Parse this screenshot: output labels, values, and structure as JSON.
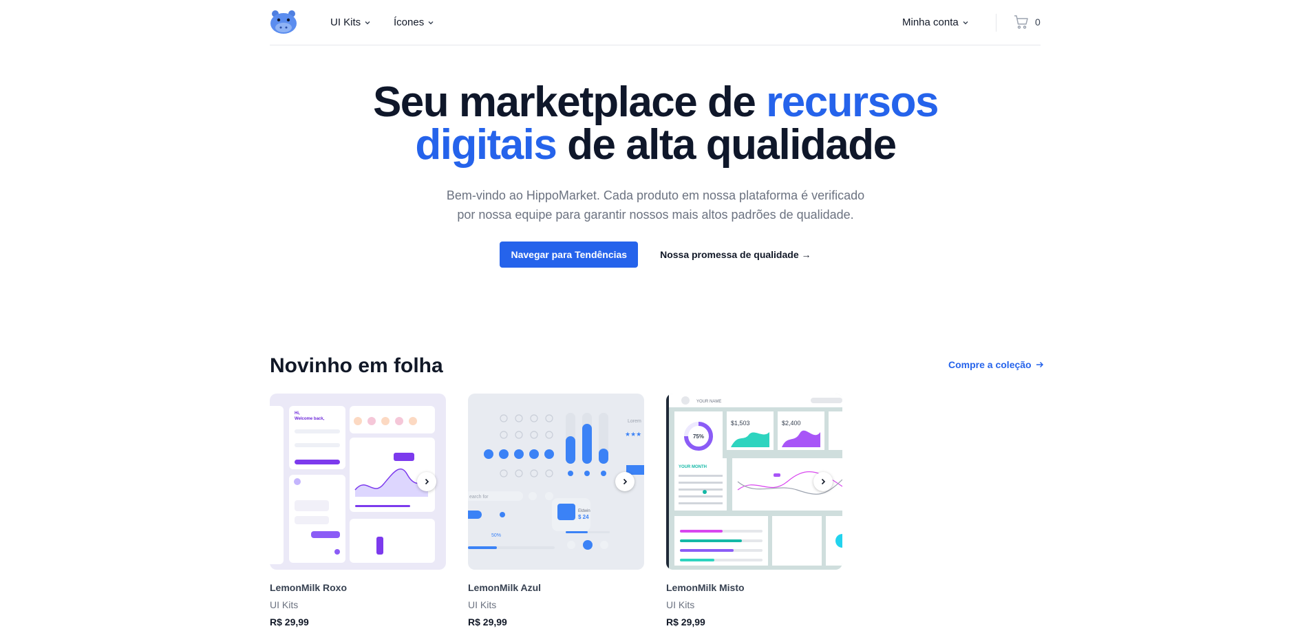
{
  "nav": {
    "items": [
      {
        "label": "UI Kits"
      },
      {
        "label": "Ícones"
      }
    ],
    "account_label": "Minha conta",
    "cart_count": "0"
  },
  "hero": {
    "title_part1": "Seu marketplace de ",
    "title_highlight1": "recursos",
    "title_highlight2": "digitais",
    "title_part2": " de alta qualidade",
    "subtitle": "Bem-vindo ao HippoMarket. Cada produto em nossa plataforma é verificado por nossa equipe para garantir nossos mais altos padrões de qualidade.",
    "primary_button": "Navegar para Tendências",
    "secondary_button": "Nossa promessa de qualidade →"
  },
  "section": {
    "title": "Novinho em folha",
    "link": "Compre a coleção"
  },
  "products": [
    {
      "name": "LemonMilk Roxo",
      "category": "UI Kits",
      "price": "R$ 29,99"
    },
    {
      "name": "LemonMilk Azul",
      "category": "UI Kits",
      "price": "R$ 29,99"
    },
    {
      "name": "LemonMilk Misto",
      "category": "UI Kits",
      "price": "R$ 29,99"
    }
  ],
  "thumb_text": {
    "roxo_greeting": "Hi,",
    "roxo_welcome": "Welcome back,",
    "azul_search": "earch for",
    "azul_percent": "50%",
    "azul_price": "$ 24",
    "misto_name": "YOUR NAME",
    "misto_percent": "75%",
    "misto_val1": "$1,503",
    "misto_val2": "$2,400",
    "misto_month": "YOUR MONTH"
  },
  "colors": {
    "accent": "#2563eb",
    "roxo": "#8b5cf6",
    "azul": "#3b82f6",
    "misto_teal": "#14b8a6"
  }
}
